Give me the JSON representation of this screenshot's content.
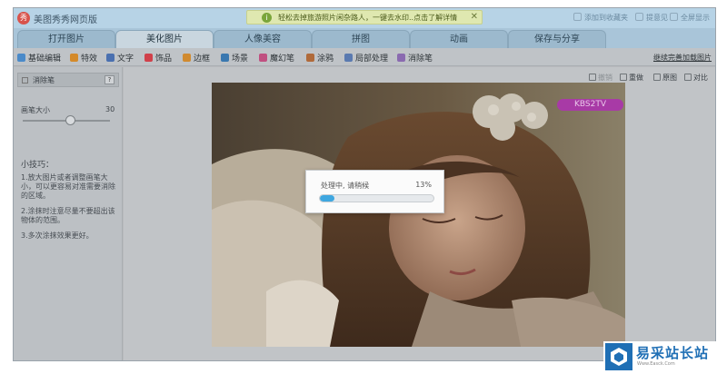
{
  "app": {
    "title": "美图秀秀网页版",
    "logo_glyph": "秀"
  },
  "notice": {
    "text": "轻松去掉旅游照片闲杂路人，一键去水印..点击了解详情",
    "close": "✕"
  },
  "title_links": [
    {
      "label": "添加到收藏夹"
    },
    {
      "label": "提意见"
    },
    {
      "label": "全屏显示"
    }
  ],
  "tabs": [
    {
      "label": "打开图片"
    },
    {
      "label": "美化图片"
    },
    {
      "label": "人像美容"
    },
    {
      "label": "拼图"
    },
    {
      "label": "动画"
    },
    {
      "label": "保存与分享"
    }
  ],
  "active_tab": "美化图片",
  "tools": [
    {
      "label": "基础编辑",
      "icon": "edit-icon",
      "color": "#4a8ac9"
    },
    {
      "label": "特效",
      "icon": "wand-icon",
      "color": "#d48a2a"
    },
    {
      "label": "文字",
      "icon": "text-icon",
      "color": "#4a70b0"
    },
    {
      "label": "饰品",
      "icon": "bow-icon",
      "color": "#d0404a"
    },
    {
      "label": "边框",
      "icon": "frame-icon",
      "color": "#d08a30"
    },
    {
      "label": "场景",
      "icon": "scene-icon",
      "color": "#3a78b0"
    },
    {
      "label": "魔幻笔",
      "icon": "magic-pen-icon",
      "color": "#c05080"
    },
    {
      "label": "涂鸦",
      "icon": "brush-icon",
      "color": "#b06a3a"
    },
    {
      "label": "局部处理",
      "icon": "local-icon",
      "color": "#5a7ab0"
    },
    {
      "label": "消除笔",
      "icon": "eraser-icon",
      "color": "#8a6ab0"
    }
  ],
  "toolbar_right": "继续完善加载图片",
  "panel": {
    "title": "消除笔",
    "help": "?",
    "brush_label": "画笔大小",
    "brush_value": "30",
    "brush_level": 0.55,
    "tips_title": "小技巧：",
    "tips": [
      "1.放大图片或者调整画笔大小，可以更容易对准需要消除的区域。",
      "2.涂抹时注意尽量不要超出该物体的范围。",
      "3.多次涂抹效果更好。"
    ]
  },
  "canvas_buttons": [
    {
      "label": "撤销",
      "icon": "undo-icon",
      "enabled": false
    },
    {
      "label": "重做",
      "icon": "redo-icon",
      "enabled": true
    },
    {
      "label": "原图",
      "icon": "original-icon",
      "enabled": true
    },
    {
      "label": "对比",
      "icon": "compare-icon",
      "enabled": true
    }
  ],
  "watermark_text": "KBS2TV",
  "progress": {
    "text": "处理中, 请稍候",
    "percent_label": "13%",
    "value": 0.13
  },
  "corner_badge": {
    "title": "易采站长站",
    "subtitle": "Www.Easck.Com"
  }
}
